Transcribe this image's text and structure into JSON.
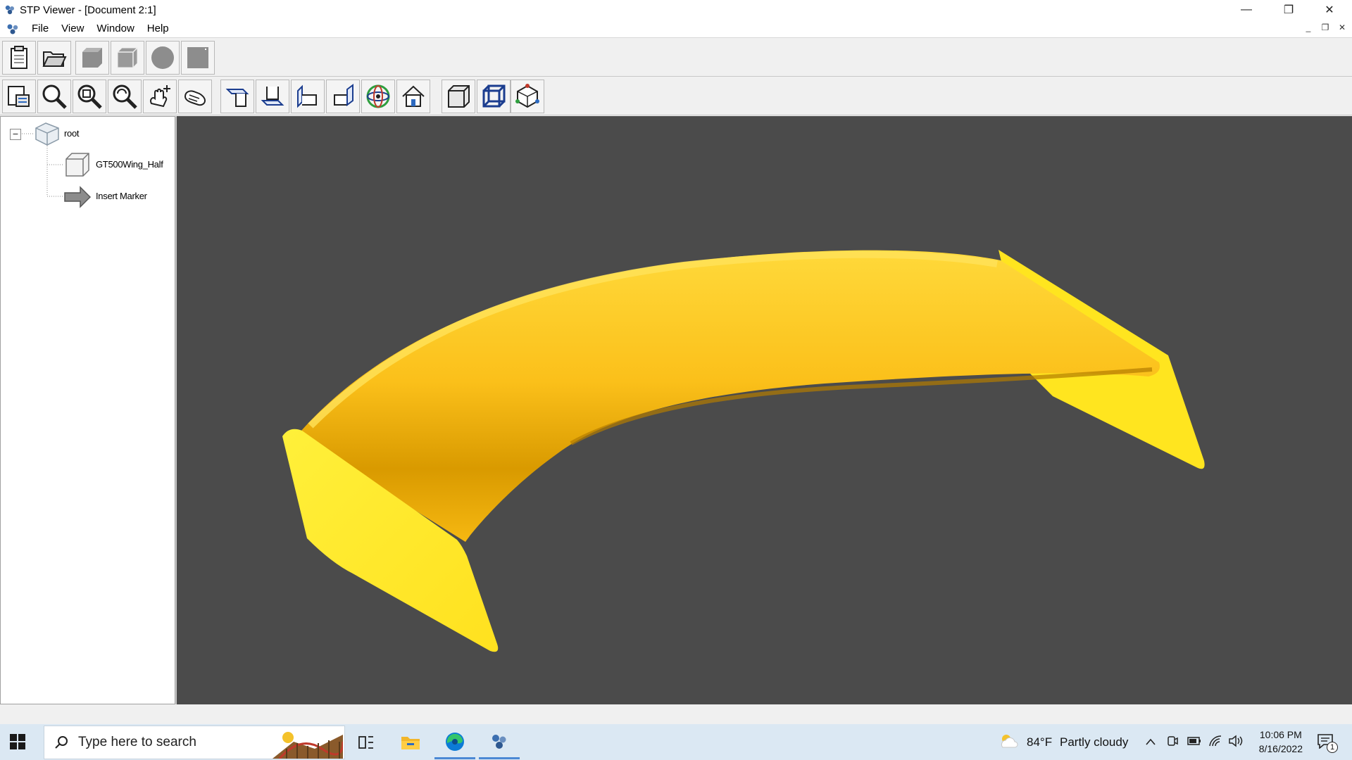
{
  "window": {
    "title": "STP Viewer - [Document 2:1]",
    "controls": {
      "minimize": "—",
      "restore": "❐",
      "close": "✕"
    }
  },
  "menubar": {
    "items": [
      "File",
      "View",
      "Window",
      "Help"
    ],
    "mdi_controls": {
      "minimize": "_",
      "restore": "❐",
      "close": "✕"
    }
  },
  "toolbar1": {
    "buttons": [
      "clipboard-icon",
      "open-folder-icon",
      "shaded-box-icon",
      "shaded-box-edges-icon",
      "sphere-icon",
      "plane-icon"
    ]
  },
  "toolbar2": {
    "buttons": [
      "fit-page-icon",
      "zoom-icon",
      "zoom-window-icon",
      "zoom-dynamic-icon",
      "pan-icon",
      "rotate-hand-icon",
      "view-top-icon",
      "view-bottom-icon",
      "view-left-icon",
      "view-right-icon",
      "view-iso-icon",
      "view-home-icon",
      "solid-cube-icon",
      "wireframe-cube-icon",
      "axes-cube-icon"
    ]
  },
  "tree": {
    "root": {
      "label": "root",
      "expander": "−"
    },
    "children": [
      {
        "label": "GT500Wing_Half",
        "icon": "part-cube-icon"
      },
      {
        "label": "Insert Marker",
        "icon": "arrow-marker-icon"
      }
    ]
  },
  "viewport": {
    "background": "#4b4b4b",
    "model_color": "#ffd21a",
    "model": "GT500Wing_Half"
  },
  "taskbar": {
    "search_placeholder": "Type here to search",
    "weather": {
      "temp": "84°F",
      "condition": "Partly cloudy"
    },
    "clock": {
      "time": "10:06 PM",
      "date": "8/16/2022"
    },
    "notifications": "1",
    "apps": [
      "task-view-icon",
      "file-explorer-icon",
      "edge-icon",
      "stp-viewer-icon"
    ]
  }
}
